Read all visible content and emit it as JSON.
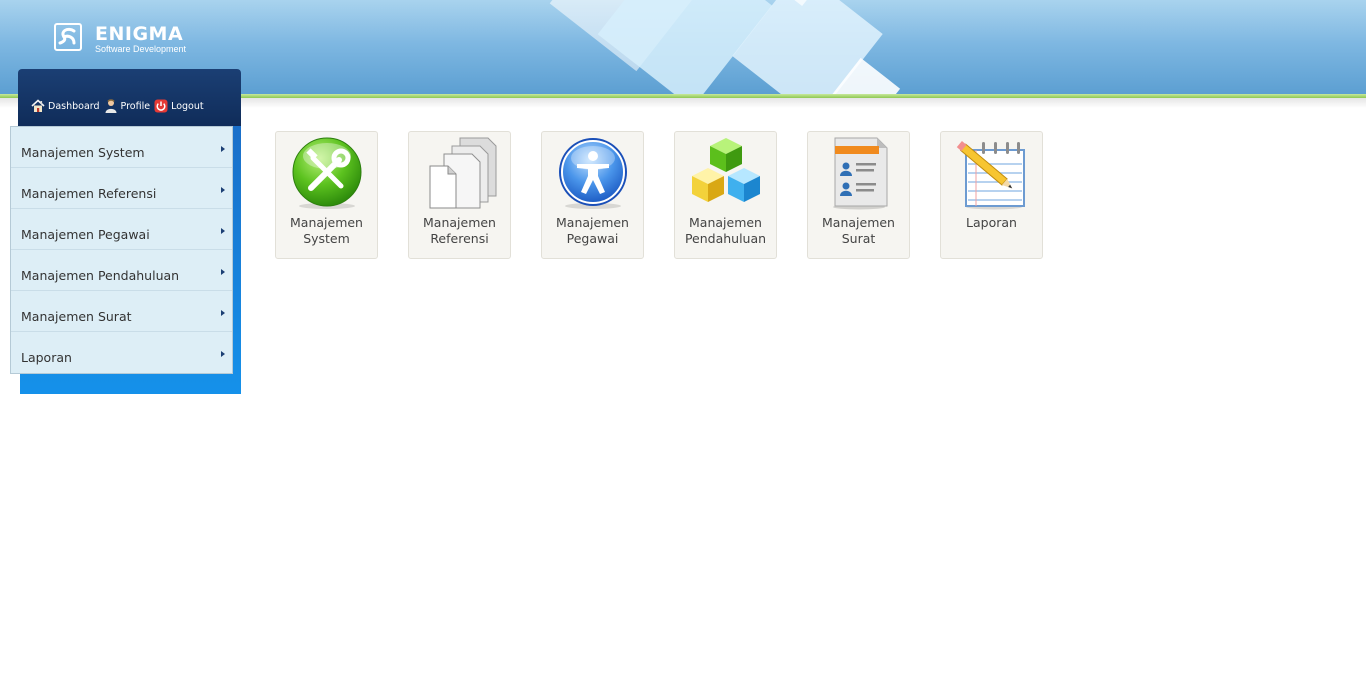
{
  "brand": {
    "name": "ENIGMA",
    "tagline": "Software Development"
  },
  "quick_links": [
    {
      "label": "Dashboard",
      "icon": "home-icon"
    },
    {
      "label": "Profile",
      "icon": "user-icon"
    },
    {
      "label": "Logout",
      "icon": "power-icon"
    }
  ],
  "menu": [
    {
      "label": "Manajemen System"
    },
    {
      "label": "Manajemen Referensi"
    },
    {
      "label": "Manajemen Pegawai"
    },
    {
      "label": "Manajemen Pendahuluan"
    },
    {
      "label": "Manajemen Surat"
    },
    {
      "label": "Laporan"
    }
  ],
  "tiles": [
    {
      "line1": "Manajemen",
      "line2": "System",
      "icon": "tools-icon"
    },
    {
      "line1": "Manajemen",
      "line2": "Referensi",
      "icon": "documents-icon"
    },
    {
      "line1": "Manajemen",
      "line2": "Pegawai",
      "icon": "person-icon"
    },
    {
      "line1": "Manajemen",
      "line2": "Pendahuluan",
      "icon": "cubes-icon"
    },
    {
      "line1": "Manajemen",
      "line2": "Surat",
      "icon": "contact-list-icon"
    },
    {
      "line1": "Laporan",
      "line2": "",
      "icon": "notepad-pencil-icon"
    }
  ],
  "colors": {
    "header_blue": "#7fb8e2",
    "accent_green": "#8ec853",
    "panel_dark": "#0f2b58",
    "panel_blue": "#1591ea",
    "menu_bg": "#ddeef6"
  }
}
